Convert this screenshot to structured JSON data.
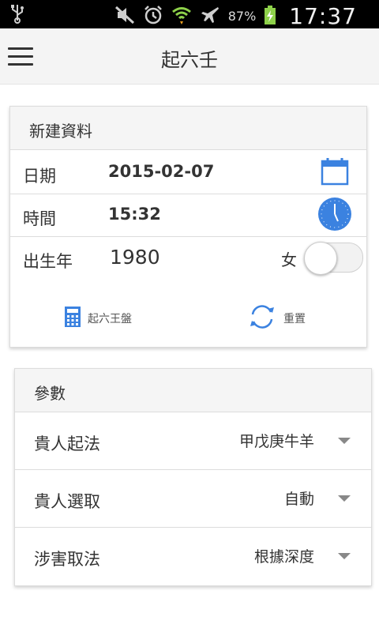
{
  "status_bar": {
    "battery": "87%",
    "time": "17:37"
  },
  "app_bar": {
    "title": "起六壬"
  },
  "new_data": {
    "header": "新建資料",
    "date_label": "日期",
    "date_value": "2015-02-07",
    "time_label": "時間",
    "time_value": "15:32",
    "birth_year_label": "出生年",
    "birth_year_value": "1980",
    "gender_label": "女",
    "gender_toggle_on": false,
    "start_button_label": "起六王盤",
    "reset_button_label": "重置"
  },
  "params": {
    "header": "參數",
    "rows": [
      {
        "label": "貴人起法",
        "value": "甲戊庚牛羊"
      },
      {
        "label": "貴人選取",
        "value": "自動"
      },
      {
        "label": "涉害取法",
        "value": "根據深度"
      }
    ]
  },
  "colors": {
    "accent": "#3a7bd5",
    "icon_blue": "#3b82e0"
  }
}
